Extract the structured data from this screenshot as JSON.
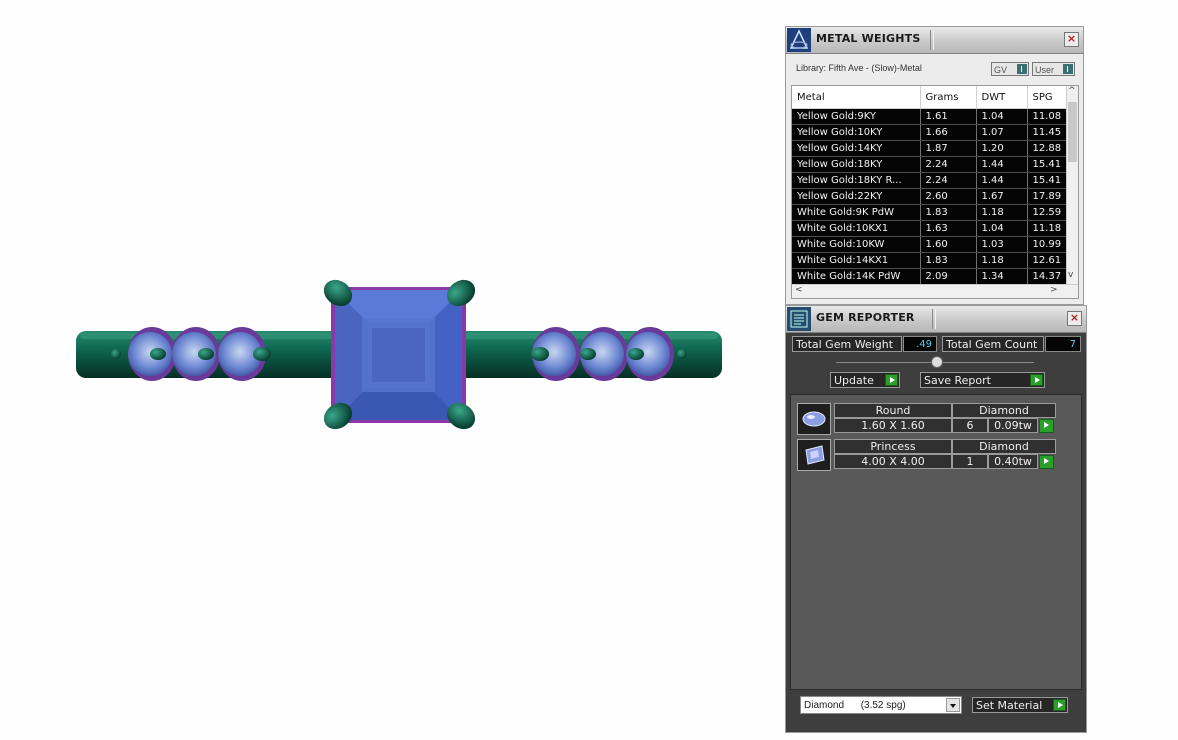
{
  "metal_weights": {
    "title": "METAL WEIGHTS",
    "library_label": "Library: Fifth Ave - (Slow)-Metal",
    "toggle_gv": "GV",
    "toggle_user": "User",
    "columns": [
      "Metal",
      "Grams",
      "DWT",
      "SPG"
    ],
    "rows": [
      [
        "Yellow Gold:9KY",
        "1.61",
        "1.04",
        "11.08"
      ],
      [
        "Yellow Gold:10KY",
        "1.66",
        "1.07",
        "11.45"
      ],
      [
        "Yellow Gold:14KY",
        "1.87",
        "1.20",
        "12.88"
      ],
      [
        "Yellow Gold:18KY",
        "2.24",
        "1.44",
        "15.41"
      ],
      [
        "Yellow Gold:18KY R...",
        "2.24",
        "1.44",
        "15.41"
      ],
      [
        "Yellow Gold:22KY",
        "2.60",
        "1.67",
        "17.89"
      ],
      [
        "White Gold:9K PdW",
        "1.83",
        "1.18",
        "12.59"
      ],
      [
        "White Gold:10KX1",
        "1.63",
        "1.04",
        "11.18"
      ],
      [
        "White Gold:10KW",
        "1.60",
        "1.03",
        "10.99"
      ],
      [
        "White Gold:14KX1",
        "1.83",
        "1.18",
        "12.61"
      ],
      [
        "White Gold:14K PdW",
        "2.09",
        "1.34",
        "14.37"
      ]
    ]
  },
  "gem_reporter": {
    "title": "GEM REPORTER",
    "total_weight_label": "Total Gem Weight",
    "total_weight_value": ".49",
    "total_count_label": "Total Gem Count",
    "total_count_value": "7",
    "update_label": "Update",
    "save_report_label": "Save Report",
    "gems": [
      {
        "shape": "Round",
        "material": "Diamond",
        "size": "1.60 X 1.60",
        "count": "6",
        "weight": "0.09tw"
      },
      {
        "shape": "Princess",
        "material": "Diamond",
        "size": "4.00 X 4.00",
        "count": "1",
        "weight": "0.40tw"
      }
    ],
    "material_select": "Diamond      (3.52 spg)",
    "set_material_label": "Set Material"
  },
  "colors": {
    "metal_green": "#0e5a48",
    "gem_blue": "#4466cc",
    "prong_purple": "#8a3aa8",
    "go_green": "#2aa02a"
  }
}
